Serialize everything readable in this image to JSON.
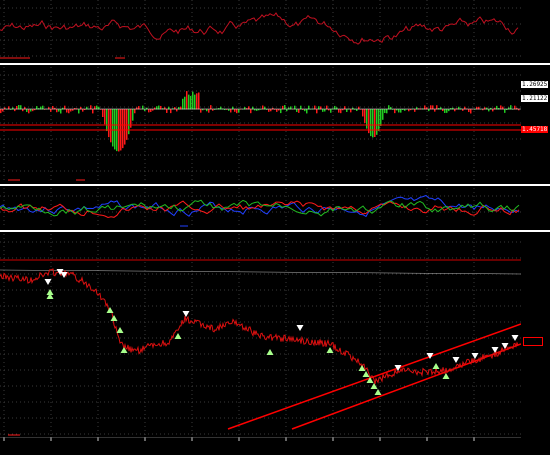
{
  "macd_pane": {
    "labels": [
      {
        "text": "1.26925",
        "bg": "#ffffff",
        "fg": "#000000"
      },
      {
        "text": "1.21122",
        "bg": "#ffffff",
        "fg": "#000000"
      },
      {
        "text": "1.45718",
        "bg": "#ff0000",
        "fg": "#ffffff"
      }
    ]
  },
  "price_pane": {
    "last_price_label": ""
  },
  "colors": {
    "background": "#000000",
    "grid": "#3a3a3a",
    "bull": "#22cc22",
    "bear": "#ff1a1a",
    "line": "#ff0000",
    "up_marker": "#a8ff8c",
    "down_marker": "#ffffff",
    "osc_blue": "#2040ff",
    "osc_green": "#22bb22",
    "separator": "#ffffff"
  },
  "icons": {
    "buy_marker": "triangle-up-icon",
    "sell_marker": "triangle-down-icon"
  }
}
